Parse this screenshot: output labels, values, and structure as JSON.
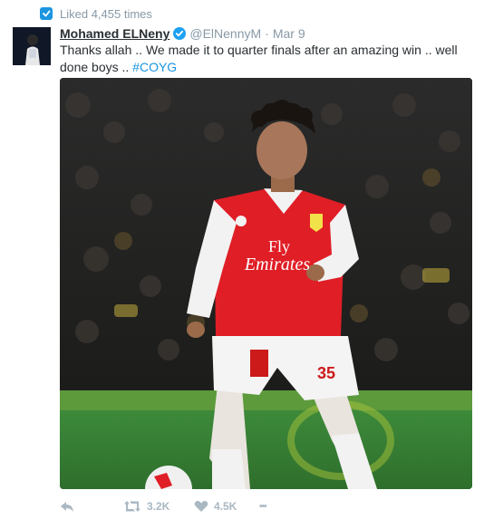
{
  "context": {
    "label": "Liked 4,455 times",
    "icon": "like-context-icon"
  },
  "tweet": {
    "author_name": "Mohamed ELNeny",
    "author_handle": "@ElNennyM",
    "separator": "·",
    "date": "Mar 9",
    "text": "Thanks allah .. We made it to quarter finals after an amazing win .. well done boys .. ",
    "hashtag": "#COYG",
    "photo_text": {
      "sponsor_line1": "Fly",
      "sponsor_line2": "Emirates",
      "shirt_number": "35"
    }
  },
  "actions": {
    "reply_icon": "reply-icon",
    "retweet_count": "3.2K",
    "like_count": "4.5K",
    "more_label": "•••"
  },
  "colors": {
    "accent": "#1b95e0",
    "muted": "#8899a6",
    "action": "#aab8c2",
    "text": "#292f33"
  }
}
